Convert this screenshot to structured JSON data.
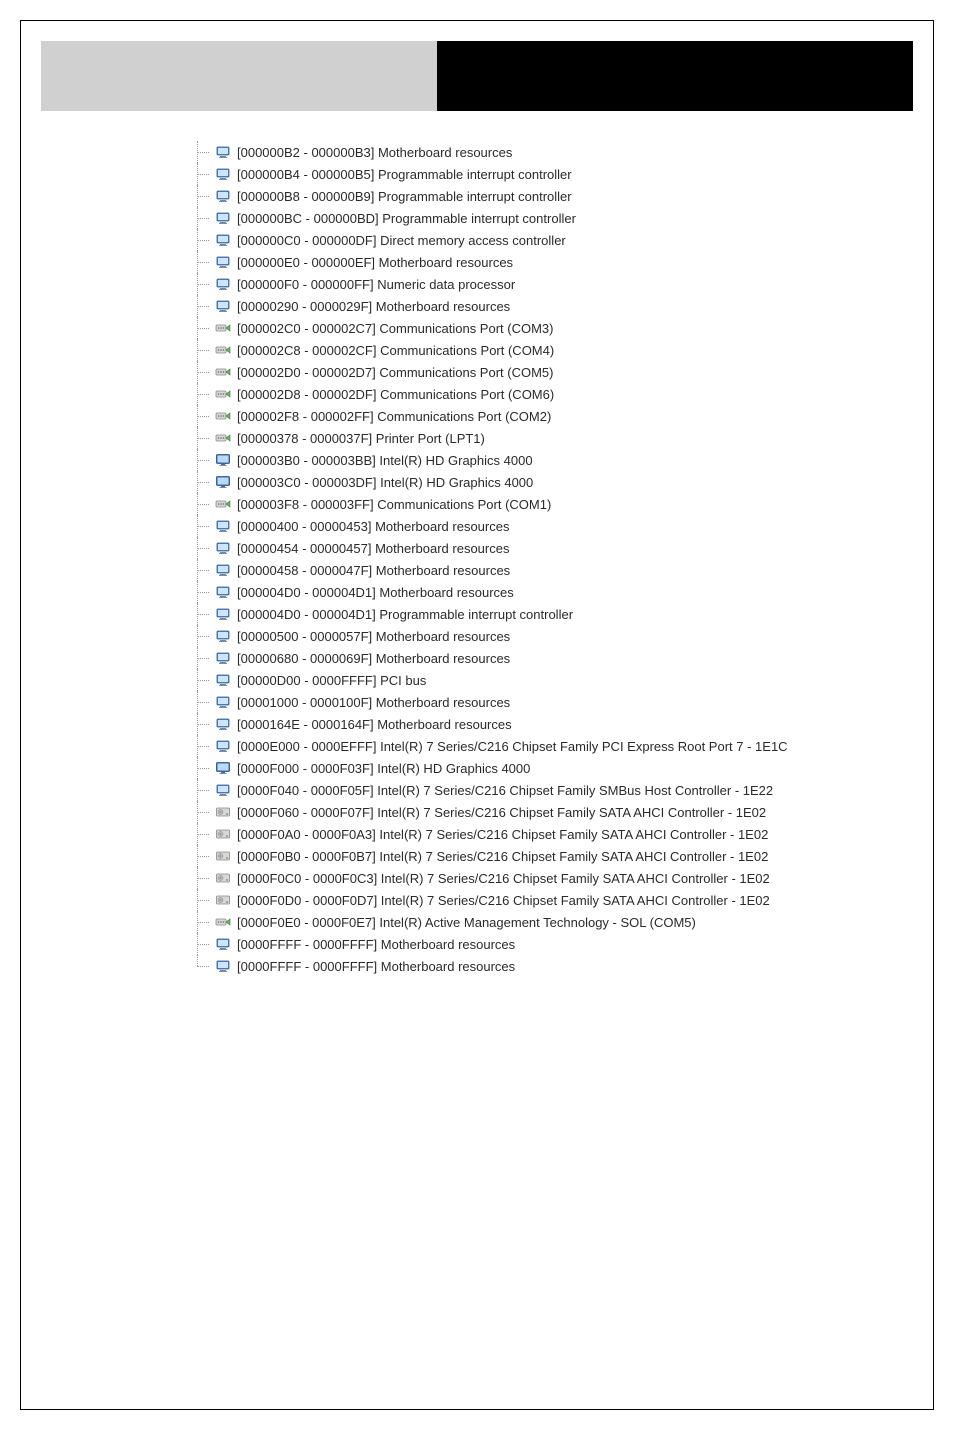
{
  "icons": {
    "computer": "computer-icon",
    "port": "port-icon",
    "display": "display-icon",
    "disk": "disk-icon"
  },
  "resources": [
    {
      "icon": "computer",
      "text": "[000000B2 - 000000B3]  Motherboard resources"
    },
    {
      "icon": "computer",
      "text": "[000000B4 - 000000B5]  Programmable interrupt controller"
    },
    {
      "icon": "computer",
      "text": "[000000B8 - 000000B9]  Programmable interrupt controller"
    },
    {
      "icon": "computer",
      "text": "[000000BC - 000000BD]  Programmable interrupt controller"
    },
    {
      "icon": "computer",
      "text": "[000000C0 - 000000DF]  Direct memory access controller"
    },
    {
      "icon": "computer",
      "text": "[000000E0 - 000000EF]  Motherboard resources"
    },
    {
      "icon": "computer",
      "text": "[000000F0 - 000000FF]  Numeric data processor"
    },
    {
      "icon": "computer",
      "text": "[00000290 - 0000029F]  Motherboard resources"
    },
    {
      "icon": "port",
      "text": "[000002C0 - 000002C7]  Communications Port (COM3)"
    },
    {
      "icon": "port",
      "text": "[000002C8 - 000002CF]  Communications Port (COM4)"
    },
    {
      "icon": "port",
      "text": "[000002D0 - 000002D7]  Communications Port (COM5)"
    },
    {
      "icon": "port",
      "text": "[000002D8 - 000002DF]  Communications Port (COM6)"
    },
    {
      "icon": "port",
      "text": "[000002F8 - 000002FF]  Communications Port (COM2)"
    },
    {
      "icon": "port",
      "text": "[00000378 - 0000037F]  Printer Port (LPT1)"
    },
    {
      "icon": "display",
      "text": "[000003B0 - 000003BB]  Intel(R) HD Graphics 4000"
    },
    {
      "icon": "display",
      "text": "[000003C0 - 000003DF]  Intel(R) HD Graphics 4000"
    },
    {
      "icon": "port",
      "text": "[000003F8 - 000003FF]  Communications Port (COM1)"
    },
    {
      "icon": "computer",
      "text": "[00000400 - 00000453]  Motherboard resources"
    },
    {
      "icon": "computer",
      "text": "[00000454 - 00000457]  Motherboard resources"
    },
    {
      "icon": "computer",
      "text": "[00000458 - 0000047F]  Motherboard resources"
    },
    {
      "icon": "computer",
      "text": "[000004D0 - 000004D1]  Motherboard resources"
    },
    {
      "icon": "computer",
      "text": "[000004D0 - 000004D1]  Programmable interrupt controller"
    },
    {
      "icon": "computer",
      "text": "[00000500 - 0000057F]  Motherboard resources"
    },
    {
      "icon": "computer",
      "text": "[00000680 - 0000069F]  Motherboard resources"
    },
    {
      "icon": "computer",
      "text": "[00000D00 - 0000FFFF]  PCI bus"
    },
    {
      "icon": "computer",
      "text": "[00001000 - 0000100F]  Motherboard resources"
    },
    {
      "icon": "computer",
      "text": "[0000164E - 0000164F]  Motherboard resources"
    },
    {
      "icon": "computer",
      "text": "[0000E000 - 0000EFFF]  Intel(R) 7 Series/C216 Chipset Family PCI Express Root Port 7 - 1E1C"
    },
    {
      "icon": "display",
      "text": "[0000F000 - 0000F03F]  Intel(R) HD Graphics 4000"
    },
    {
      "icon": "computer",
      "text": "[0000F040 - 0000F05F]  Intel(R) 7 Series/C216 Chipset Family SMBus Host Controller - 1E22"
    },
    {
      "icon": "disk",
      "text": "[0000F060 - 0000F07F]  Intel(R) 7 Series/C216 Chipset Family SATA AHCI Controller - 1E02"
    },
    {
      "icon": "disk",
      "text": "[0000F0A0 - 0000F0A3]  Intel(R) 7 Series/C216 Chipset Family SATA AHCI Controller - 1E02"
    },
    {
      "icon": "disk",
      "text": "[0000F0B0 - 0000F0B7]  Intel(R) 7 Series/C216 Chipset Family SATA AHCI Controller - 1E02"
    },
    {
      "icon": "disk",
      "text": "[0000F0C0 - 0000F0C3]  Intel(R) 7 Series/C216 Chipset Family SATA AHCI Controller - 1E02"
    },
    {
      "icon": "disk",
      "text": "[0000F0D0 - 0000F0D7]  Intel(R) 7 Series/C216 Chipset Family SATA AHCI Controller - 1E02"
    },
    {
      "icon": "port",
      "text": "[0000F0E0 - 0000F0E7]  Intel(R) Active Management Technology - SOL (COM5)"
    },
    {
      "icon": "computer",
      "text": "[0000FFFF - 0000FFFF]  Motherboard resources"
    },
    {
      "icon": "computer",
      "text": "[0000FFFF - 0000FFFF]  Motherboard resources"
    }
  ]
}
